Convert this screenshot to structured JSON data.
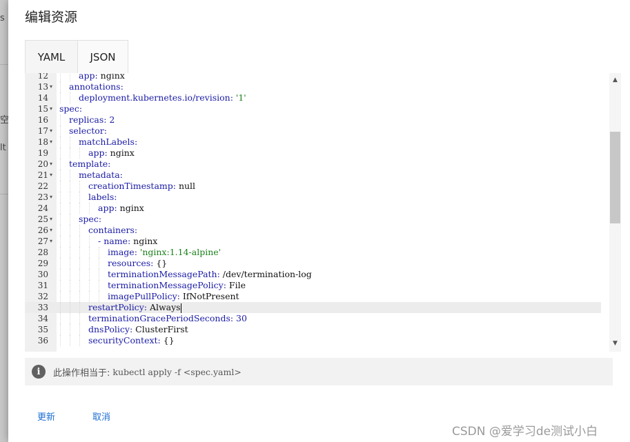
{
  "background": {
    "fragments": [
      "s",
      "空",
      "lt"
    ]
  },
  "dialog": {
    "title": "编辑资源",
    "tabs": [
      {
        "label": "YAML"
      },
      {
        "label": "JSON"
      }
    ]
  },
  "editor": {
    "active_line": 33,
    "lines": [
      {
        "n": "12",
        "fold": false,
        "indent": 2,
        "key": "app",
        "value": "nginx",
        "vtype": "plain"
      },
      {
        "n": "13",
        "fold": true,
        "indent": 1,
        "key": "annotations",
        "value": "",
        "vtype": "plain"
      },
      {
        "n": "14",
        "fold": false,
        "indent": 2,
        "key": "deployment.kubernetes.io/revision",
        "value": "'1'",
        "vtype": "string"
      },
      {
        "n": "15",
        "fold": true,
        "indent": 0,
        "key": "spec",
        "value": "",
        "vtype": "plain"
      },
      {
        "n": "16",
        "fold": false,
        "indent": 1,
        "key": "replicas",
        "value": "2",
        "vtype": "number"
      },
      {
        "n": "17",
        "fold": true,
        "indent": 1,
        "key": "selector",
        "value": "",
        "vtype": "plain"
      },
      {
        "n": "18",
        "fold": true,
        "indent": 2,
        "key": "matchLabels",
        "value": "",
        "vtype": "plain"
      },
      {
        "n": "19",
        "fold": false,
        "indent": 3,
        "key": "app",
        "value": "nginx",
        "vtype": "plain"
      },
      {
        "n": "20",
        "fold": true,
        "indent": 1,
        "key": "template",
        "value": "",
        "vtype": "plain"
      },
      {
        "n": "21",
        "fold": true,
        "indent": 2,
        "key": "metadata",
        "value": "",
        "vtype": "plain"
      },
      {
        "n": "22",
        "fold": false,
        "indent": 3,
        "key": "creationTimestamp",
        "value": "null",
        "vtype": "plain"
      },
      {
        "n": "23",
        "fold": true,
        "indent": 3,
        "key": "labels",
        "value": "",
        "vtype": "plain"
      },
      {
        "n": "24",
        "fold": false,
        "indent": 4,
        "key": "app",
        "value": "nginx",
        "vtype": "plain"
      },
      {
        "n": "25",
        "fold": true,
        "indent": 2,
        "key": "spec",
        "value": "",
        "vtype": "plain"
      },
      {
        "n": "26",
        "fold": true,
        "indent": 3,
        "key": "containers",
        "value": "",
        "vtype": "plain"
      },
      {
        "n": "27",
        "fold": true,
        "indent": 4,
        "key": "- name",
        "value": "nginx",
        "vtype": "plain"
      },
      {
        "n": "28",
        "fold": false,
        "indent": 5,
        "key": "image",
        "value": "'nginx:1.14-alpine'",
        "vtype": "string"
      },
      {
        "n": "29",
        "fold": false,
        "indent": 5,
        "key": "resources",
        "value": "{}",
        "vtype": "plain"
      },
      {
        "n": "30",
        "fold": false,
        "indent": 5,
        "key": "terminationMessagePath",
        "value": "/dev/termination-log",
        "vtype": "plain"
      },
      {
        "n": "31",
        "fold": false,
        "indent": 5,
        "key": "terminationMessagePolicy",
        "value": "File",
        "vtype": "plain"
      },
      {
        "n": "32",
        "fold": false,
        "indent": 5,
        "key": "imagePullPolicy",
        "value": "IfNotPresent",
        "vtype": "plain"
      },
      {
        "n": "33",
        "fold": false,
        "indent": 3,
        "key": "restartPolicy",
        "value": "Always",
        "vtype": "plain"
      },
      {
        "n": "34",
        "fold": false,
        "indent": 3,
        "key": "terminationGracePeriodSeconds",
        "value": "30",
        "vtype": "number"
      },
      {
        "n": "35",
        "fold": false,
        "indent": 3,
        "key": "dnsPolicy",
        "value": "ClusterFirst",
        "vtype": "plain"
      },
      {
        "n": "36",
        "fold": false,
        "indent": 3,
        "key": "securityContext",
        "value": "{}",
        "vtype": "plain"
      }
    ]
  },
  "info": {
    "label": "此操作相当于:",
    "command": "kubectl apply -f <spec.yaml>"
  },
  "actions": {
    "update_label": "更新",
    "cancel_label": "取消"
  },
  "watermark": "CSDN @爱学习de测试小白",
  "colors": {
    "accent": "#1e6fd4",
    "key": "#1a1aa6",
    "string": "#1a7f1a"
  }
}
